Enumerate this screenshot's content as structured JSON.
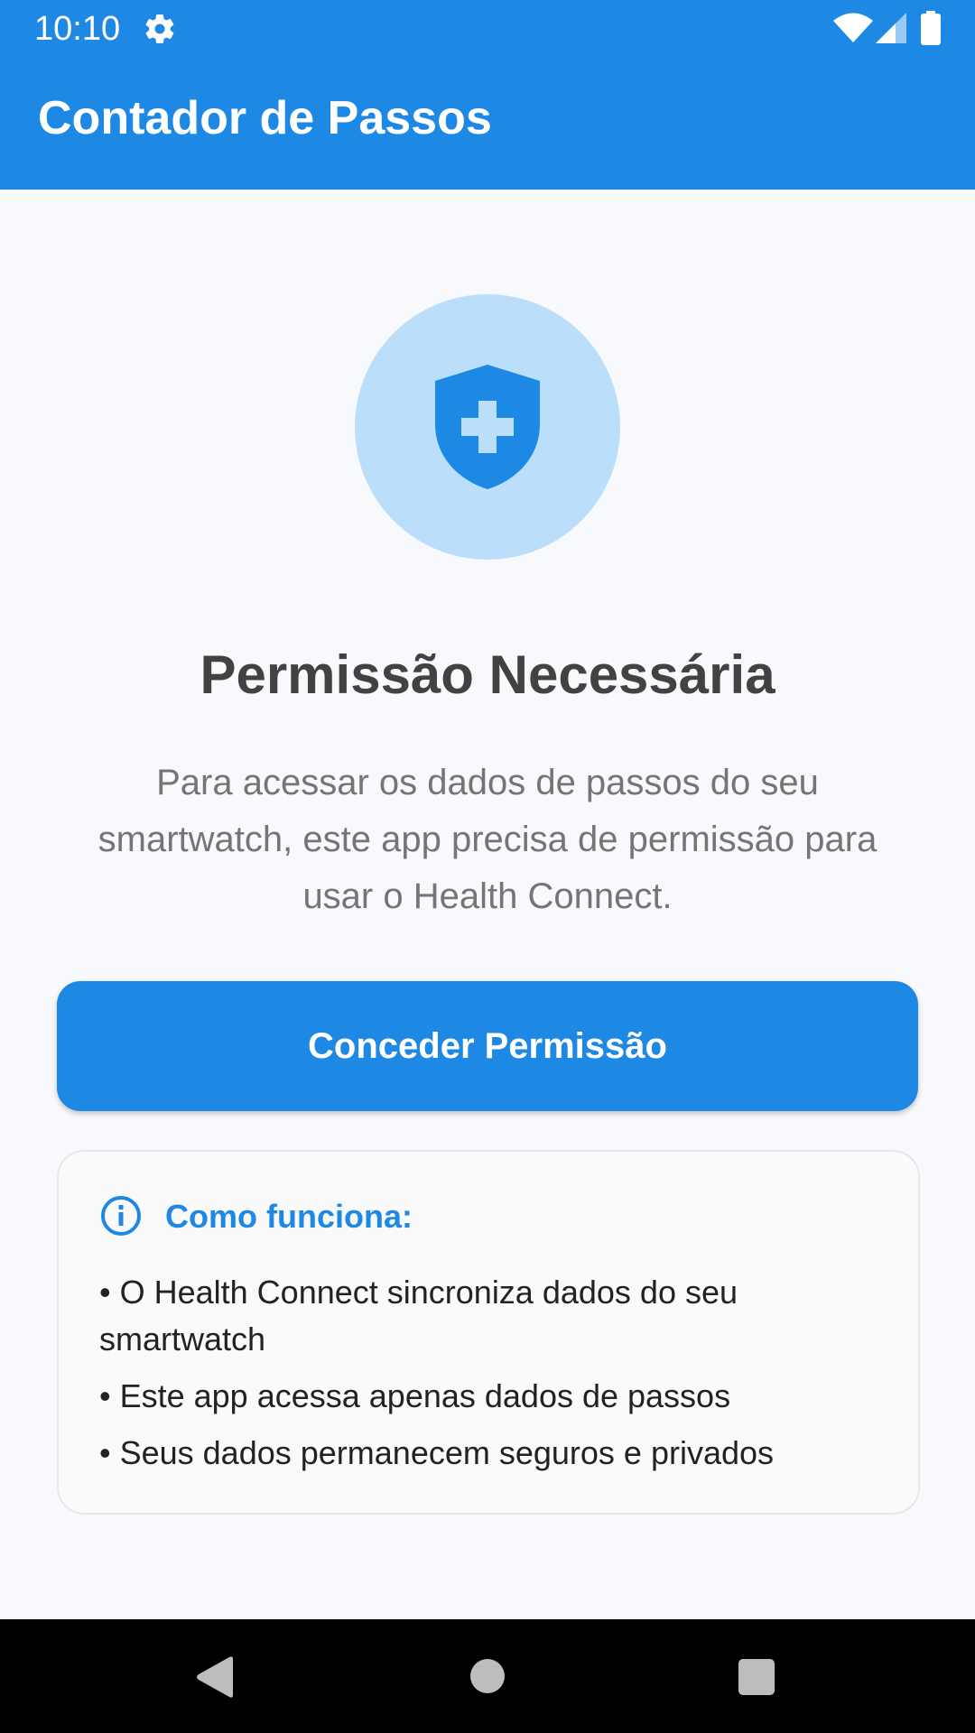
{
  "status_bar": {
    "time": "10:10",
    "icons": [
      "gear-icon",
      "wifi-icon",
      "signal-icon",
      "battery-icon"
    ]
  },
  "app_bar": {
    "title": "Contador de Passos"
  },
  "permission": {
    "icon": "shield-plus-icon",
    "heading": "Permissão Necessária",
    "description_lines": [
      "Para acessar os dados de passos do seu",
      "smartwatch, este app precisa de permissão para",
      "usar o Health Connect."
    ],
    "button_label": "Conceder Permissão"
  },
  "info_card": {
    "icon": "info-icon",
    "title": "Como funciona:",
    "items": [
      [
        "• O Health Connect sincroniza dados do seu",
        "smartwatch"
      ],
      [
        "• Este app acessa apenas dados de passos"
      ],
      [
        "• Seus dados permanecem seguros e privados"
      ]
    ]
  },
  "nav_bar": {
    "icons": [
      "back-icon",
      "home-icon",
      "recents-icon"
    ]
  },
  "colors": {
    "primary": "#1e88e5",
    "icon_background": "#bbdefb",
    "page_background": "#f8f9fd",
    "heading_text": "#424242",
    "body_text": "#757575"
  }
}
